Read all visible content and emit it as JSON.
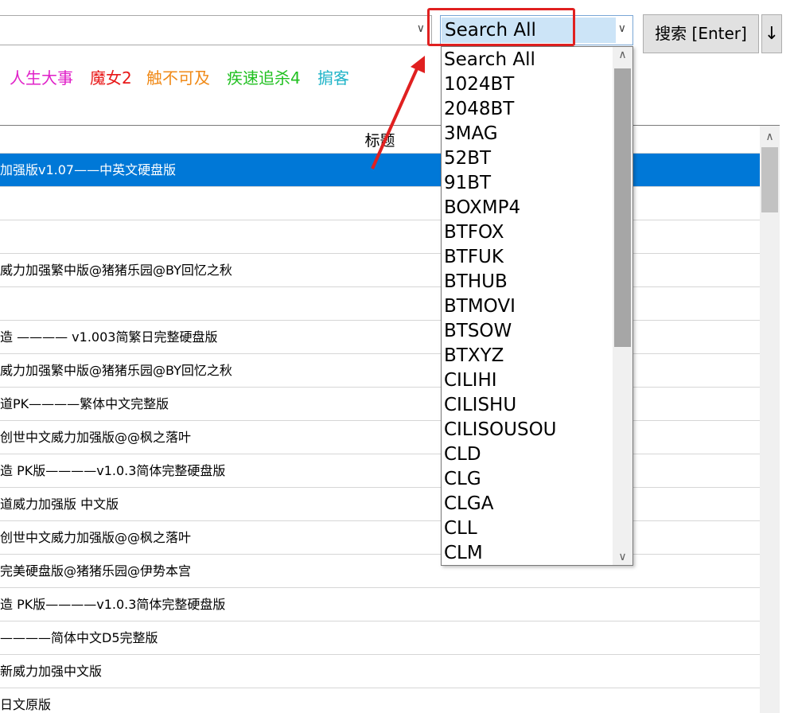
{
  "search_input": {
    "value": ""
  },
  "site_select": {
    "selected": "Search All",
    "options": [
      "Search All",
      "1024BT",
      "2048BT",
      "3MAG",
      "52BT",
      "91BT",
      "BOXMP4",
      "BTFOX",
      "BTFUK",
      "BTHUB",
      "BTMOVI",
      "BTSOW",
      "BTXYZ",
      "CILIHI",
      "CILISHU",
      "CILISOUSOU",
      "CLD",
      "CLG",
      "CLGA",
      "CLL",
      "CLM"
    ]
  },
  "buttons": {
    "search_label": "搜索 [Enter]",
    "sort_label": "↓"
  },
  "hot_keywords": [
    {
      "text": "人生大事",
      "color": "#e020c8"
    },
    {
      "text": "魔女2",
      "color": "#e81818"
    },
    {
      "text": "触不可及",
      "color": "#f08a18"
    },
    {
      "text": "疾速追杀4",
      "color": "#20c020"
    },
    {
      "text": "掮客",
      "color": "#20b4c8"
    }
  ],
  "table": {
    "header_title": "标题",
    "rows": [
      "加强版v1.07——中英文硬盘版",
      "",
      "",
      "威力加强繁中版@猪猪乐园@BY回忆之秋",
      "",
      "造 ———— v1.003简繁日完整硬盘版",
      "威力加强繁中版@猪猪乐园@BY回忆之秋",
      "道PK————繁体中文完整版",
      "创世中文威力加强版@@枫之落叶",
      "造 PK版————v1.0.3简体完整硬盘版",
      "道威力加强版 中文版",
      "创世中文威力加强版@@枫之落叶",
      "完美硬盘版@猪猪乐园@伊势本宫",
      "造 PK版————v1.0.3简体完整硬盘版",
      "————简体中文D5完整版",
      "新威力加强中文版",
      "日文原版"
    ]
  },
  "colors": {
    "selection": "#0078d7",
    "highlight_box": "#e02020",
    "arrow": "#e02020"
  }
}
